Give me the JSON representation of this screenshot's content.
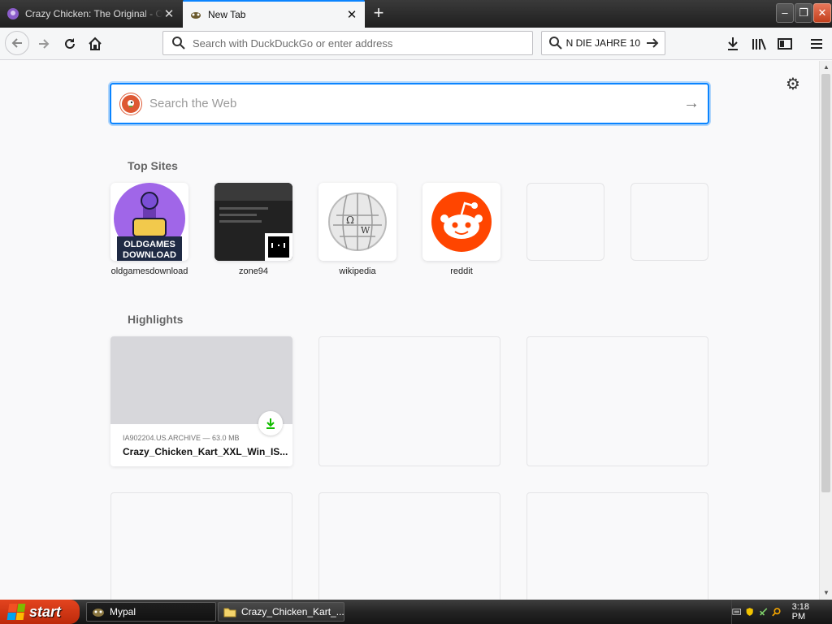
{
  "tabs": [
    {
      "title": "Crazy Chicken: The Original - Old",
      "active": false
    },
    {
      "title": "New Tab",
      "active": true
    }
  ],
  "window_controls": {
    "minimize": "–",
    "restore": "❐",
    "close": "✕"
  },
  "navbar": {
    "url_placeholder": "Search with DuckDuckGo or enter address",
    "search_value": "N DIE JAHRE 10"
  },
  "newtab": {
    "search_placeholder": "Search the Web",
    "top_sites_title": "Top Sites",
    "top_sites": [
      {
        "label": "oldgamesdownload"
      },
      {
        "label": "zone94"
      },
      {
        "label": "wikipedia"
      },
      {
        "label": "reddit"
      },
      {
        "label": ""
      },
      {
        "label": ""
      }
    ],
    "oldgames_logo_text": [
      "OLDGAMES",
      "DOWNLOAD"
    ],
    "highlights_title": "Highlights",
    "highlight": {
      "meta": "IA902204.US.ARCHIVE — 63.0 MB",
      "title": "Crazy_Chicken_Kart_XXL_Win_IS..."
    }
  },
  "taskbar": {
    "start_label": "start",
    "tasks": [
      {
        "label": "Mypal"
      },
      {
        "label": "Crazy_Chicken_Kart_..."
      }
    ],
    "clock": "3:18 PM"
  },
  "colors": {
    "accent": "#0a84ff",
    "reddit": "#ff4500",
    "download_green": "#12bc00",
    "start_red": "#d8401a"
  }
}
